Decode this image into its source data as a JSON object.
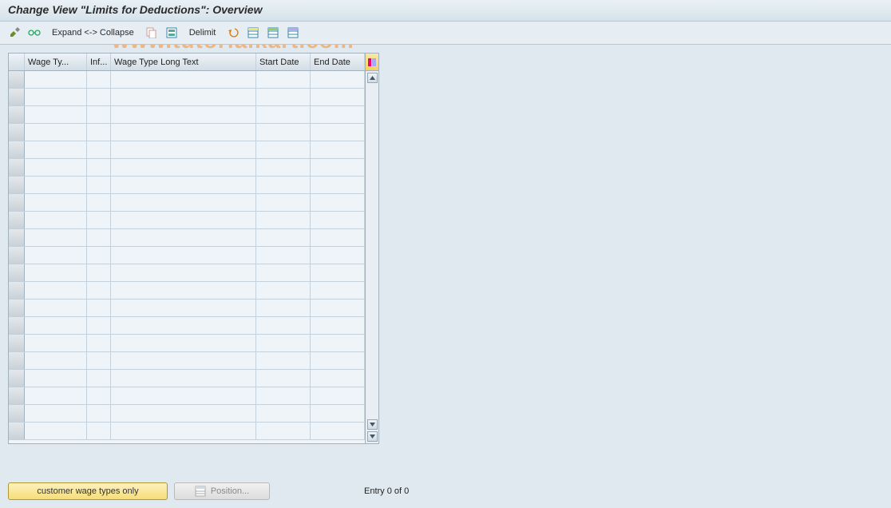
{
  "header": {
    "title": "Change View \"Limits for Deductions\": Overview"
  },
  "watermark": "www.tutorialkart.com",
  "toolbar": {
    "expand_collapse": "Expand <-> Collapse",
    "delimit": "Delimit",
    "icons": {
      "other_view": "other-view-icon",
      "glasses": "glasses-icon",
      "copy": "copy-icon",
      "select_all": "select-all-icon",
      "undo": "undo-icon",
      "table1": "grid-icon-1",
      "table2": "grid-icon-2",
      "table3": "grid-icon-3"
    }
  },
  "table": {
    "columns": {
      "wage_type": "Wage Ty...",
      "inf": "Inf...",
      "long_text": "Wage Type Long Text",
      "start_date": "Start Date",
      "end_date": "End Date"
    },
    "row_count": 21
  },
  "footer": {
    "customer_btn": "customer wage types only",
    "position_btn": "Position...",
    "entry_text": "Entry 0 of 0"
  }
}
